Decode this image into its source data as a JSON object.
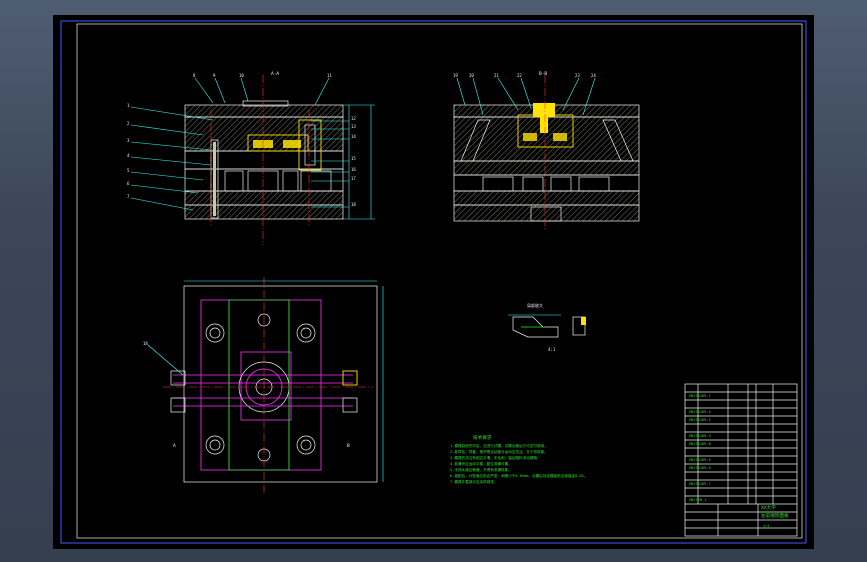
{
  "drawing": {
    "title_block": {
      "part_title": "左前端饰面板",
      "company": "XX大学",
      "sheet": "1:1"
    },
    "notes": {
      "heading": "技术要求",
      "lines": [
        "1.模具制造完毕后，应进行试模，试模合格后方可交付使用。",
        "2.各导柱、导套、推杆等活动部分运动应灵活，无卡滞现象。",
        "3.模具的浇注系统应平滑，无毛刺，保证熔料流动顺畅。",
        "4.各滑块应运动平稳，复位准确可靠。",
        "5.冷却水道应畅通，不得有渗漏现象。",
        "6.装配后，分型面应贴合严密，间隙小于0.05mm，合模后动定模板贴合面保证0.02。",
        "7.模具外露部分应涂防锈漆。"
      ]
    },
    "section_labels": {
      "front": "A-A",
      "side": "B-B",
      "detail": "局部放大",
      "detail_scale": "4:1",
      "plan_a": "A",
      "plan_b": "B"
    },
    "part_numbers_left": [
      "1",
      "2",
      "3",
      "4",
      "5",
      "6",
      "7"
    ],
    "part_numbers_right": [
      "12",
      "13",
      "14",
      "15",
      "16",
      "17",
      "18"
    ],
    "part_numbers_top": [
      "8",
      "9",
      "10",
      "11"
    ],
    "part_numbers_side": [
      "19",
      "20",
      "21",
      "22",
      "23",
      "24"
    ],
    "bom_codes": [
      "GB/T4169.1",
      "GB/T4169.4",
      "GB/T4169.2",
      "GB/T4169.3",
      "GB/T4169.8",
      "GB/T4169.5",
      "GB/T4169.6",
      "GB/T4169.7",
      "GB/T70.1"
    ],
    "plan_callout": "18"
  }
}
